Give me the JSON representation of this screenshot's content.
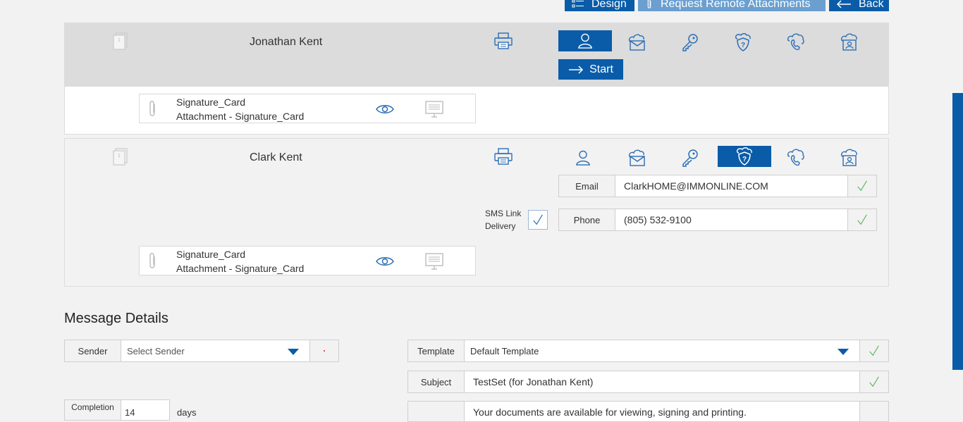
{
  "toolbar": {
    "design_label": "Design",
    "request_remote_label": "Request Remote Attachments",
    "back_label": "Back"
  },
  "signers": [
    {
      "name": "Jonathan Kent",
      "start_label": "Start",
      "active_method": "in-person-icon",
      "attachment": {
        "title": "Signature_Card",
        "subtitle": "Attachment - Signature_Card"
      }
    },
    {
      "name": "Clark Kent",
      "active_method": "security-question-icon",
      "email_label": "Email",
      "email_value": "ClarkHOME@IMMONLINE.COM",
      "phone_label": "Phone",
      "phone_value": "(805) 532-9100",
      "sms_label_line1": "SMS Link",
      "sms_label_line2": "Delivery",
      "attachment": {
        "title": "Signature_Card",
        "subtitle": "Attachment - Signature_Card"
      }
    }
  ],
  "message_details": {
    "heading": "Message Details",
    "sender_label": "Sender",
    "sender_placeholder": "Select Sender",
    "template_label": "Template",
    "template_value": "Default Template",
    "subject_label": "Subject",
    "subject_value": "TestSet (for Jonathan Kent)",
    "completion_label": "Completion",
    "completion_value": "14",
    "completion_unit": "days",
    "message_value": "Your documents are available for viewing, signing and printing."
  },
  "colors": {
    "primary": "#0a5ca8",
    "primary_light": "#6a9fd0",
    "check_green": "#5cb85c",
    "required_red": "#d9534f"
  }
}
